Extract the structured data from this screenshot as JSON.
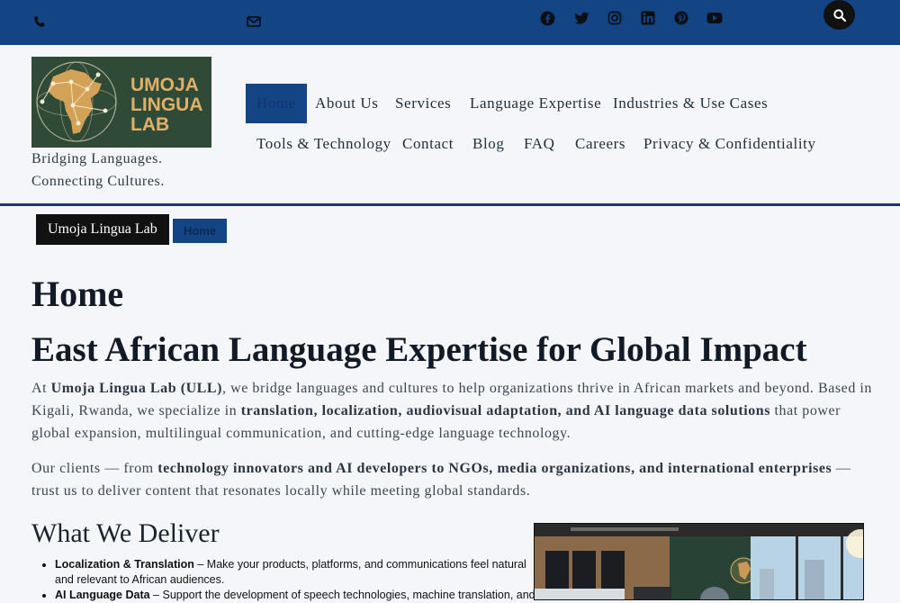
{
  "topbar": {
    "phone_icon": "phone-icon",
    "email_icon": "envelope-icon",
    "social": [
      "facebook-icon",
      "twitter-icon",
      "instagram-icon",
      "linkedin-icon",
      "pinterest-icon",
      "youtube-icon"
    ],
    "search_icon": "search-icon"
  },
  "brand": {
    "logo_lines": [
      "UMOJA",
      "LINGUA",
      "LAB"
    ],
    "tagline_line1": "Bridging Languages.",
    "tagline_line2": "Connecting Cultures."
  },
  "nav": {
    "items": [
      {
        "label": "Home",
        "active": true
      },
      {
        "label": "About Us"
      },
      {
        "label": "Services"
      },
      {
        "label": "Language Expertise"
      },
      {
        "label": "Industries & Use Cases"
      },
      {
        "label": "Tools & Technology"
      },
      {
        "label": "Contact"
      },
      {
        "label": "Blog"
      },
      {
        "label": "FAQ"
      },
      {
        "label": "Careers"
      },
      {
        "label": "Privacy & Confidentiality"
      }
    ]
  },
  "breadcrumb": {
    "site": "Umoja Lingua Lab",
    "current": "Home"
  },
  "page": {
    "title": "Home",
    "headline": "East African Language Expertise for Global Impact",
    "p1": {
      "a": "At ",
      "b": "Umoja Lingua Lab (ULL)",
      "c": ", we bridge languages and cultures to help organizations thrive in African markets and beyond. Based in Kigali, Rwanda, we specialize in ",
      "d": "translation, localization, audiovisual adaptation, and AI language data solutions",
      "e": " that power global expansion, multilingual communication, and cutting-edge language technology."
    },
    "p2": {
      "a": "Our clients — from ",
      "b": "technology innovators and AI developers to NGOs, media organizations, and international enterprises",
      "c": " — trust us to deliver content that resonates locally while meeting global standards."
    },
    "section_title": "What We Deliver",
    "deliver": [
      {
        "title": "Localization & Translation",
        "text": " – Make your products, platforms, and communications feel natural and relevant to African audiences."
      },
      {
        "title": "AI Language Data",
        "text": " – Support the development of speech technologies, machine translation, and"
      }
    ]
  },
  "colors": {
    "topbar": "#134585",
    "accent": "#134585",
    "logo_bg": "#2f4a37",
    "logo_text": "#e0b069"
  }
}
